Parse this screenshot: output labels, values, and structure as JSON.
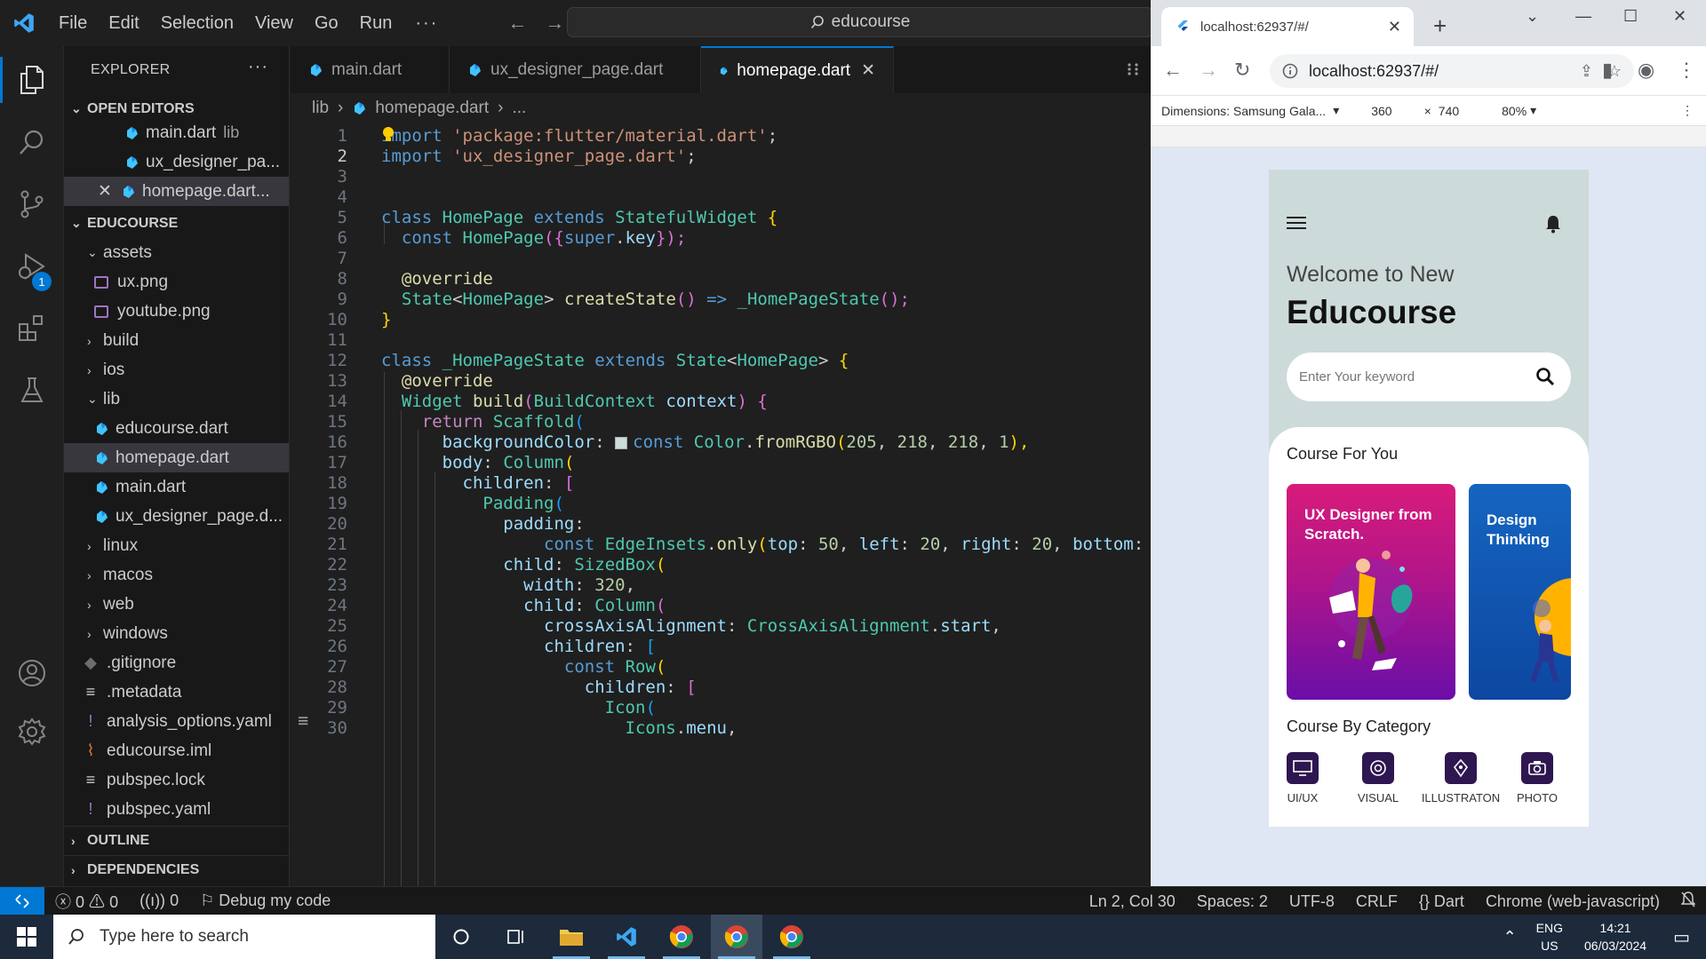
{
  "menu": {
    "file": "File",
    "edit": "Edit",
    "selection": "Selection",
    "view": "View",
    "go": "Go",
    "run": "Run",
    "more": "···"
  },
  "command_center": {
    "text": "educourse"
  },
  "activity_badge": "1",
  "explorer": {
    "title": "EXPLORER",
    "more": "···",
    "open_editors_label": "OPEN EDITORS",
    "open_editors": [
      {
        "name": "main.dart",
        "desc": "lib"
      },
      {
        "name": "ux_designer_pa...",
        "desc": ""
      },
      {
        "name": "homepage.dart...",
        "desc": ""
      }
    ],
    "project_label": "EDUCOURSE",
    "tree": {
      "assets": "assets",
      "ux_png": "ux.png",
      "youtube_png": "youtube.png",
      "build": "build",
      "ios": "ios",
      "lib": "lib",
      "educourse_dart": "educourse.dart",
      "homepage_dart": "homepage.dart",
      "main_dart": "main.dart",
      "ux_designer_page": "ux_designer_page.d...",
      "linux": "linux",
      "macos": "macos",
      "web": "web",
      "windows": "windows",
      "gitignore": ".gitignore",
      "metadata": ".metadata",
      "analysis_options": "analysis_options.yaml",
      "educourse_iml": "educourse.iml",
      "pubspec_lock": "pubspec.lock",
      "pubspec_yaml": "pubspec.yaml"
    },
    "outline_label": "OUTLINE",
    "dependencies_label": "DEPENDENCIES"
  },
  "tabs": [
    {
      "label": "main.dart"
    },
    {
      "label": "ux_designer_page.dart"
    },
    {
      "label": "homepage.dart"
    }
  ],
  "breadcrumb": {
    "folder": "lib",
    "file": "homepage.dart",
    "rest": "..."
  },
  "code": {
    "line_numbers": [
      "1",
      "2",
      "3",
      "4",
      "5",
      "6",
      "7",
      "8",
      "9",
      "10",
      "11",
      "12",
      "13",
      "14",
      "15",
      "16",
      "17",
      "18",
      "19",
      "20",
      "21",
      "22",
      "23",
      "24",
      "25",
      "26",
      "27",
      "28",
      "29",
      "30"
    ],
    "l1a": "import",
    "l1b": "'package:flutter/material.dart'",
    "l1c": ";",
    "l2a": "import",
    "l2b": "'ux_designer_page.dart'",
    "l2c": ";",
    "l5a": "class",
    "l5b": "HomePage",
    "l5c": "extends",
    "l5d": "StatefulWidget",
    "l5e": "{",
    "l6a": "const",
    "l6b": "HomePage",
    "l6c": "({",
    "l6d": "super",
    "l6e": ".",
    "l6f": "key",
    "l6g": "});",
    "l8a": "@override",
    "l9a": "State",
    "l9b": "<",
    "l9c": "HomePage",
    "l9d": ">",
    "l9e": "createState",
    "l9f": "()",
    "l9g": "=>",
    "l9h": "_HomePageState",
    "l9i": "();",
    "l10a": "}",
    "l12a": "class",
    "l12b": "_HomePageState",
    "l12c": "extends",
    "l12d": "State",
    "l12e": "<",
    "l12f": "HomePage",
    "l12g": ">",
    "l12h": "{",
    "l13a": "@override",
    "l14a": "Widget",
    "l14b": "build",
    "l14c": "(",
    "l14d": "BuildContext",
    "l14e": "context",
    "l14f": ")",
    "l14g": "{",
    "l15a": "return",
    "l15b": "Scaffold",
    "l15c": "(",
    "l16a": "backgroundColor",
    "l16b": ":",
    "l16c": "const",
    "l16d": "Color",
    "l16e": ".",
    "l16f": "fromRGBO",
    "l16g": "(",
    "l16h": "205",
    "l16i": ", ",
    "l16j": "218",
    "l16k": ", ",
    "l16l": "218",
    "l16m": ", ",
    "l16n": "1",
    "l16o": "),",
    "l17a": "body",
    "l17b": ":",
    "l17c": "Column",
    "l17d": "(",
    "l18a": "children",
    "l18b": ":",
    "l18c": "[",
    "l19a": "Padding",
    "l19b": "(",
    "l20a": "padding",
    "l20b": ":",
    "l21a": "const",
    "l21b": "EdgeInsets",
    "l21c": ".",
    "l21d": "only",
    "l21e": "(",
    "l21f": "top",
    "l21g": ": ",
    "l21h": "50",
    "l21i": ", ",
    "l21j": "left",
    "l21k": ": ",
    "l21l": "20",
    "l21m": ", ",
    "l21n": "right",
    "l21o": ": ",
    "l21p": "20",
    "l21q": ", ",
    "l21r": "bottom",
    "l21s": ":",
    "l22a": "child",
    "l22b": ":",
    "l22c": "SizedBox",
    "l22d": "(",
    "l23a": "width",
    "l23b": ": ",
    "l23c": "320",
    "l23d": ",",
    "l24a": "child",
    "l24b": ":",
    "l24c": "Column",
    "l24d": "(",
    "l25a": "crossAxisAlignment",
    "l25b": ":",
    "l25c": "CrossAxisAlignment",
    "l25d": ".",
    "l25e": "start",
    "l25f": ",",
    "l26a": "children",
    "l26b": ":",
    "l26c": "[",
    "l27a": "const",
    "l27b": "Row",
    "l27c": "(",
    "l28a": "children",
    "l28b": ":",
    "l28c": "[",
    "l29a": "Icon",
    "l29b": "(",
    "l30a": "Icons",
    "l30b": ".",
    "l30c": "menu",
    "l30d": ","
  },
  "status": {
    "errors": "0",
    "warnings": "0",
    "ports": "0",
    "debug": "Debug my code",
    "position": "Ln 2, Col 30",
    "spaces": "Spaces: 2",
    "encoding": "UTF-8",
    "eol": "CRLF",
    "language": "Dart",
    "device": "Chrome (web-javascript)"
  },
  "chrome": {
    "tab_title": "localhost:62937/#/",
    "url": "localhost:62937/#/",
    "device": "Dimensions: Samsung Gala...",
    "width": "360",
    "times": "×",
    "height": "740",
    "zoom": "80%"
  },
  "app": {
    "welcome": "Welcome to New",
    "title": "Educourse",
    "search_placeholder": "Enter Your keyword",
    "course_for_you": "Course For You",
    "card1": "UX Designer from Scratch.",
    "card2": "Design Thinking The Beginner",
    "course_by_category": "Course By Category",
    "categories": [
      "UI/UX",
      "VISUAL",
      "ILLUSTRATON",
      "PHOTO"
    ]
  },
  "taskbar": {
    "search_placeholder": "Type here to search",
    "lang1": "ENG",
    "lang2": "US",
    "time": "14:21",
    "date": "06/03/2024"
  },
  "colors": {
    "accent": "#0078d4",
    "app_bg": "#cddada",
    "card1": "#b0158a",
    "card2": "#1565c0"
  }
}
